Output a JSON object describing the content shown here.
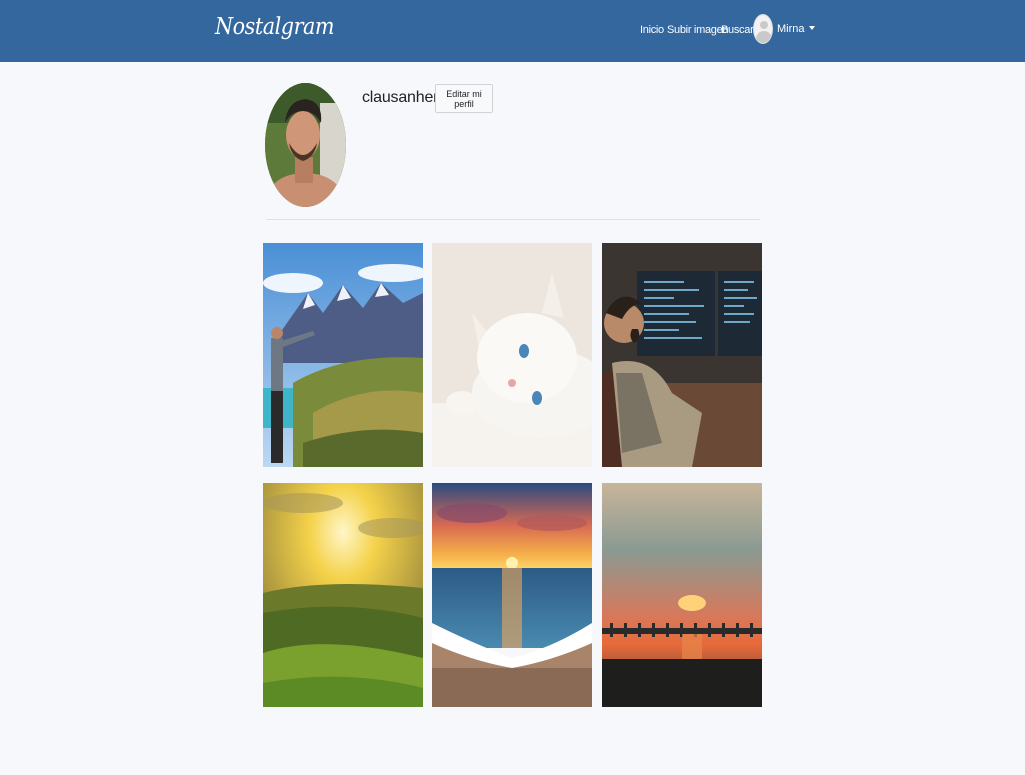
{
  "navbar": {
    "brand": "Nostalgram",
    "links": [
      {
        "label": "Inicio"
      },
      {
        "label": "Subir imagen"
      },
      {
        "label": "Buscar"
      }
    ],
    "user": {
      "name": "Mirna",
      "icon": "user-avatar-icon"
    },
    "background_color": "#34679d"
  },
  "profile": {
    "username": "clausanher",
    "edit_button_label": "Editar mi perfil"
  },
  "posts": [
    {
      "subject": "mountain-hiker"
    },
    {
      "subject": "white-kitten"
    },
    {
      "subject": "programmer-at-desk"
    },
    {
      "subject": "sunrise-hills"
    },
    {
      "subject": "ocean-sunset-waves"
    },
    {
      "subject": "pier-sunset"
    }
  ]
}
